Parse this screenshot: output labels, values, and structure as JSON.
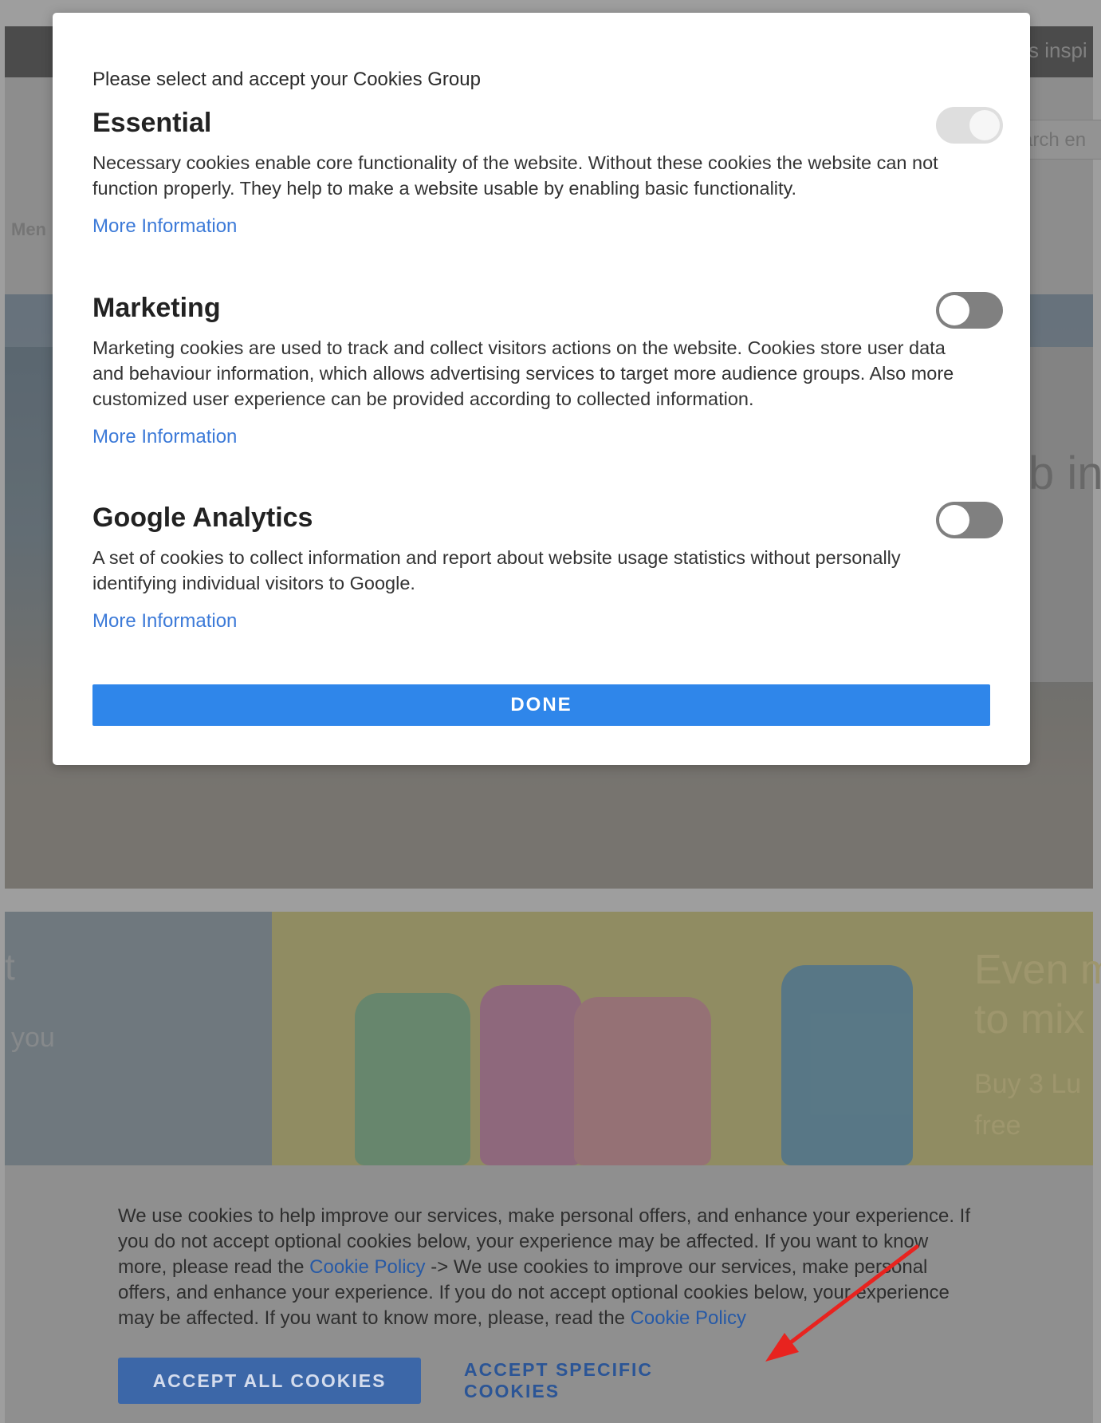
{
  "background": {
    "nav_fragment": "Men",
    "top_right_fragment": "s inspi",
    "search_fragment": "arch en",
    "hero_fragment": "b in",
    "promo_left_fragment_1": "t",
    "promo_left_fragment_2": "you",
    "promo_right_heading_1": "Even m",
    "promo_right_heading_2": "to mix",
    "promo_right_sub_1": "Buy 3 Lu",
    "promo_right_sub_2": "free"
  },
  "modal": {
    "intro": "Please select and accept your Cookies Group",
    "groups": [
      {
        "title": "Essential",
        "description": "Necessary cookies enable core functionality of the website. Without these cookies the website can not function properly. They help to make a website usable by enabling basic functionality.",
        "more_label": "More Information",
        "toggle_state": "on-disabled"
      },
      {
        "title": "Marketing",
        "description": "Marketing cookies are used to track and collect visitors actions on the website. Cookies store user data and behaviour information, which allows advertising services to target more audience groups. Also more customized user experience can be provided according to collected information.",
        "more_label": "More Information",
        "toggle_state": "off"
      },
      {
        "title": "Google Analytics",
        "description": "A set of cookies to collect information and report about website usage statistics without personally identifying individual visitors to Google.",
        "more_label": "More Information",
        "toggle_state": "off"
      }
    ],
    "done_label": "DONE"
  },
  "banner": {
    "text_part1": "We use cookies to help improve our services, make personal offers, and enhance your experience. If you do not accept optional cookies below, your experience may be affected. If you want to know more, please read the ",
    "link1": "Cookie Policy",
    "text_part2": " -> We use cookies to improve our services, make personal offers, and enhance your experience. If you do not accept optional cookies below, your experience may be affected. If you want to know more, please, read the ",
    "link2": "Cookie Policy",
    "accept_all_label": "ACCEPT ALL COOKIES",
    "accept_specific_label": "ACCEPT SPECIFIC COOKIES"
  },
  "colors": {
    "primary_blue": "#2f86ea",
    "link_blue": "#3c7ad8",
    "banner_button": "#3c67a8",
    "annotation_arrow": "#e8231f"
  }
}
